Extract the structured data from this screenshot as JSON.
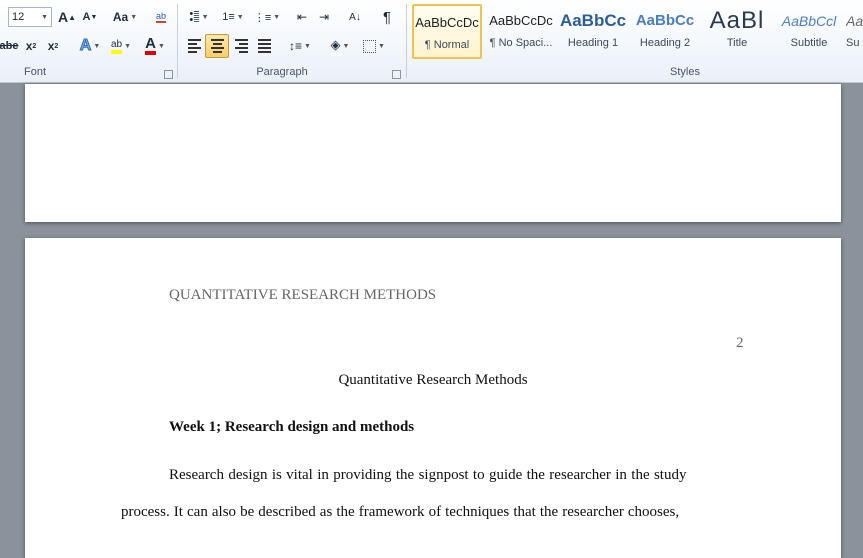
{
  "ribbon": {
    "font": {
      "group_label": "Font",
      "size_value": "12",
      "grow_font_label": "A",
      "shrink_font_label": "A",
      "change_case_label": "Aa",
      "strike_label": "abe",
      "subscript_label": "x",
      "superscript_label": "x",
      "text_effects_label": "A",
      "highlight_label": "ab",
      "font_color_label": "A",
      "clear_format_label": "ab"
    },
    "paragraph": {
      "group_label": "Paragraph",
      "pilcrow": "¶",
      "sort_label": "A↓"
    },
    "styles": {
      "group_label": "Styles",
      "items": [
        {
          "preview": "AaBbCcDc",
          "name": "¶ Normal"
        },
        {
          "preview": "AaBbCcDc",
          "name": "¶ No Spaci..."
        },
        {
          "preview": "AaBbCc",
          "name": "Heading 1"
        },
        {
          "preview": "AaBbCc",
          "name": "Heading 2"
        },
        {
          "preview": "AaBl",
          "name": "Title"
        },
        {
          "preview": "AaBbCcl",
          "name": "Subtitle"
        },
        {
          "preview": "Aa",
          "name": "Su"
        }
      ]
    },
    "colors": {
      "highlight": "#ffff00",
      "font_color": "#e00000",
      "selected_tile": "#f0c24f"
    }
  },
  "document": {
    "running_head": "QUANTITATIVE RESEARCH METHODS",
    "page_number": "2",
    "title": "Quantitative Research Methods",
    "heading": "Week 1; Research design and methods",
    "line1": "Research design is vital in providing the signpost to guide the researcher in the study",
    "line2": "process. It can also be described as the framework of techniques that the researcher chooses,"
  }
}
